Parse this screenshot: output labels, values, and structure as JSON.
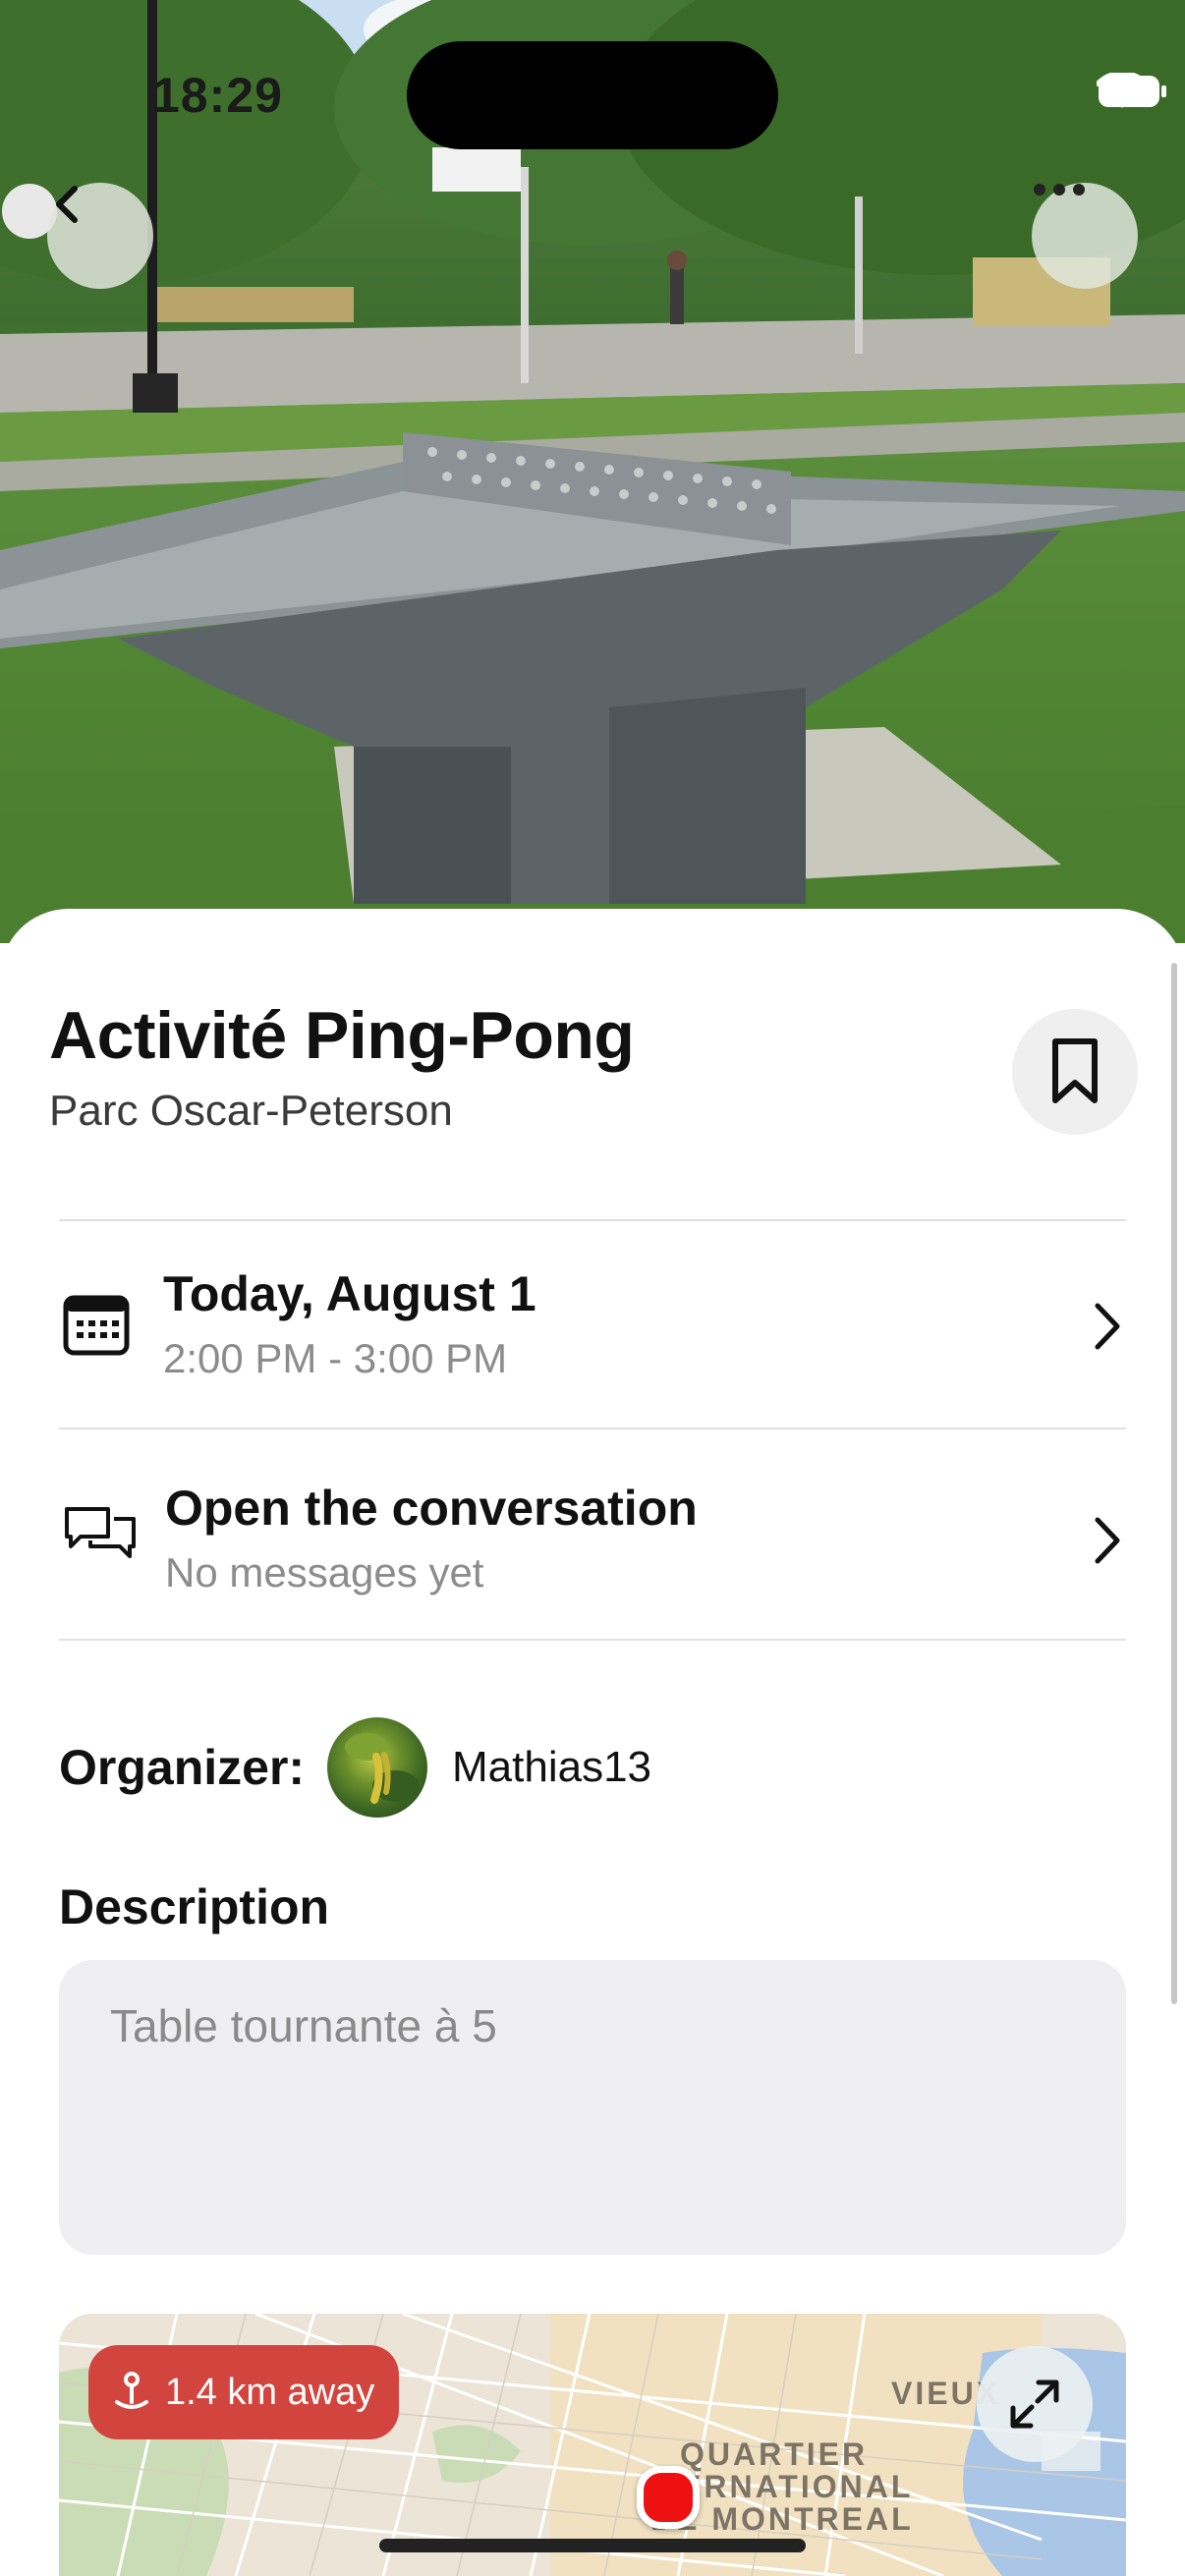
{
  "status_bar": {
    "time": "18:29"
  },
  "hero": {
    "back_icon": "chevron-left-icon",
    "more_icon": "ellipsis-icon"
  },
  "activity": {
    "title": "Activité Ping-Pong",
    "location": "Parc Oscar-Peterson",
    "bookmark_icon": "bookmark-icon"
  },
  "date_row": {
    "icon": "calendar-icon",
    "title": "Today, August 1",
    "time_range": "2:00 PM - 3:00 PM"
  },
  "conversation_row": {
    "icon": "chat-bubbles-icon",
    "title": "Open the conversation",
    "subtitle": "No messages yet"
  },
  "organizer": {
    "label": "Organizer:",
    "name": "Mathias13"
  },
  "description": {
    "label": "Description",
    "text": "Table tournante à 5"
  },
  "map": {
    "distance": "1.4 km away",
    "labels": [
      "VIEUX",
      "QUARTIER",
      "ERNATIONAL",
      "DE MONTREAL"
    ],
    "pin_color": "#e11111",
    "accent_color": "#d2453f"
  }
}
